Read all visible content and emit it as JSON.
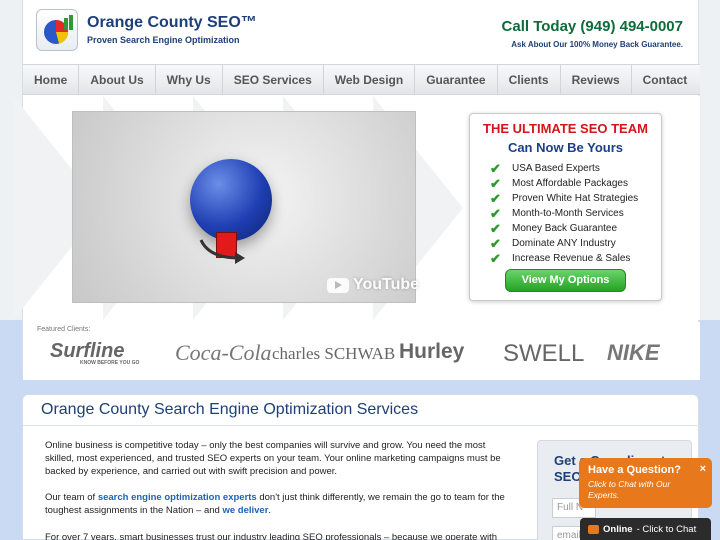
{
  "header": {
    "brand_title": "Orange County SEO™",
    "brand_subtitle": "Proven Search Engine Optimization",
    "call_text": "Call Today (949) 494-0007",
    "call_subtext": "Ask About Our 100% Money Back Guarantee."
  },
  "nav": {
    "items": [
      "Home",
      "About Us",
      "Why Us",
      "SEO Services",
      "Web Design",
      "Guarantee",
      "Clients",
      "Reviews",
      "Contact"
    ]
  },
  "hero": {
    "video_brand": "YouTube",
    "team_title": "THE ULTIMATE SEO TEAM",
    "team_subtitle": "Can Now Be Yours",
    "features": [
      "USA Based Experts",
      "Most Affordable Packages",
      "Proven White Hat Strategies",
      "Month-to-Month Services",
      "Money Back Guarantee",
      "Dominate ANY Industry",
      "Increase Revenue & Sales"
    ],
    "cta_label": "View My Options"
  },
  "clients": {
    "label": "Featured Clients:",
    "logos": [
      "Surfline",
      "KNOW BEFORE YOU GO",
      "Coca-Cola",
      "charles SCHWAB",
      "Hurley",
      "SWELL",
      "NIKE"
    ]
  },
  "main": {
    "title": "Orange County Search Engine Optimization Services",
    "paragraph1": "Online business is competitive today – only the best companies will survive and grow. You need the most skilled, most experienced, and trusted SEO experts on your team. Your online marketing campaigns must be backed by experience, and carried out with swift precision and power.",
    "p2_part1": "Our team of ",
    "p2_link1": "search engine optimization experts",
    "p2_part2": " don't just think differently, we remain the go to team for the toughest assignments in the Nation – and ",
    "p2_link2": "we deliver",
    "p2_part3": ".",
    "paragraph3": "For over 7 years, smart businesses trust our industry leading SEO professionals – because we operate with"
  },
  "sidebar": {
    "title_line1": "Get a Complimentary",
    "title_line2": "SEO Report",
    "name_placeholder": "Full N",
    "email_placeholder": "email"
  },
  "chat": {
    "title": "Have a Question?",
    "close": "×",
    "subtitle": "Click to Chat with Our Experts.",
    "status": "Online",
    "action": " - Click to Chat"
  },
  "colors": {
    "brand_blue": "#1d3f7a",
    "call_green": "#0e6b3a",
    "cta_green": "#23a323",
    "headline_red": "#d4151b",
    "chat_orange": "#e8781c"
  }
}
